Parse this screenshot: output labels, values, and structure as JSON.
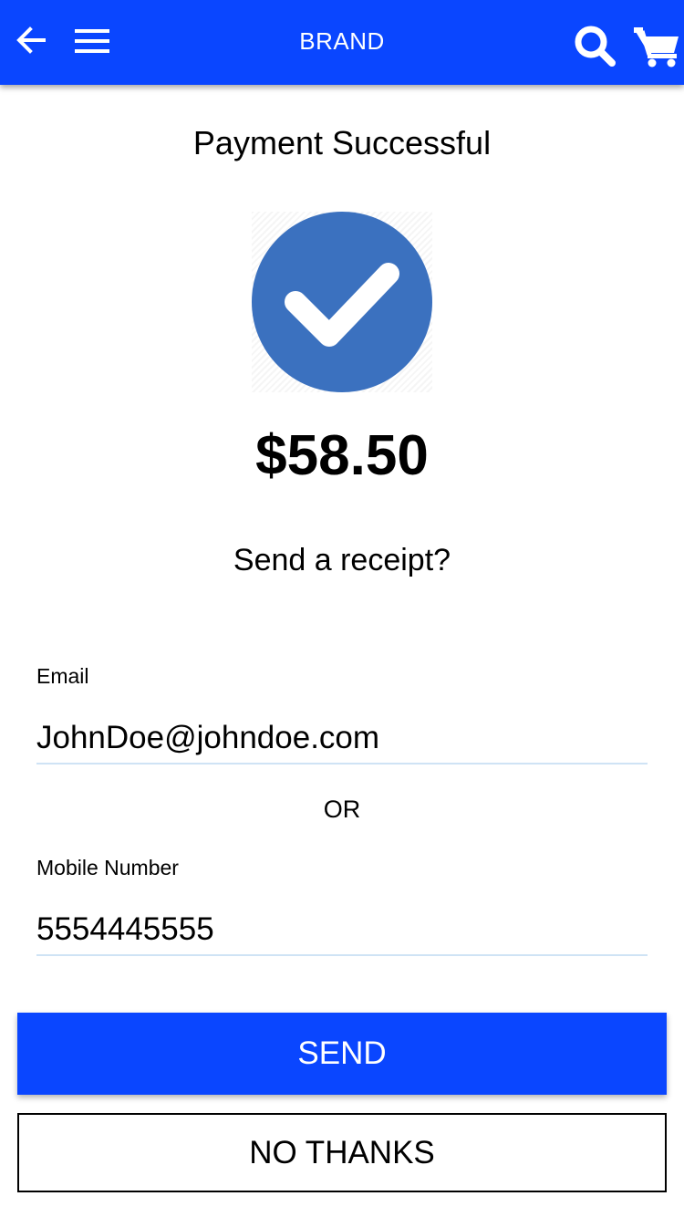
{
  "header": {
    "brand": "BRAND",
    "background_color": "#0a46ff",
    "icons": [
      "arrow-left-icon",
      "hamburger-menu-icon",
      "search-icon",
      "shopping-cart-icon"
    ]
  },
  "main": {
    "title": "Payment Successful",
    "status_icon": "check-circle-icon",
    "status_color": "#3b71bf",
    "amount": "$58.50",
    "receipt_prompt": "Send a receipt?"
  },
  "form": {
    "email_label": "Email",
    "email_value": "JohnDoe@johndoe.com",
    "or_text": "OR",
    "mobile_label": "Mobile Number",
    "mobile_value": "5554445555"
  },
  "actions": {
    "send_label": "SEND",
    "no_thanks_label": "NO THANKS",
    "accent_color": "#0a46ff"
  }
}
